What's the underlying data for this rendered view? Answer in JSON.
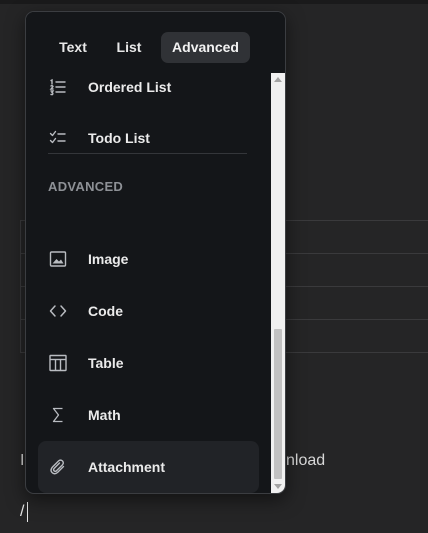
{
  "tabs": [
    {
      "label": "Text"
    },
    {
      "label": "List"
    },
    {
      "label": "Advanced",
      "active": true
    }
  ],
  "list_items_top": [
    {
      "label": "Ordered List",
      "icon": "ordered-list-icon"
    },
    {
      "label": "Todo List",
      "icon": "todo-list-icon"
    }
  ],
  "section_title": "ADVANCED",
  "advanced_items": [
    {
      "label": "Image",
      "icon": "image-icon"
    },
    {
      "label": "Code",
      "icon": "code-icon"
    },
    {
      "label": "Table",
      "icon": "table-icon"
    },
    {
      "label": "Math",
      "icon": "sigma-icon"
    },
    {
      "label": "Attachment",
      "icon": "paperclip-icon",
      "highlighted": true
    }
  ],
  "editor": {
    "text_left": "In",
    "text_right": "nload",
    "slash_command": "/"
  },
  "colors": {
    "popup_bg": "#141619",
    "active_tab_bg": "#303236",
    "highlight_bg": "#212327",
    "editor_bg": "#252526"
  }
}
